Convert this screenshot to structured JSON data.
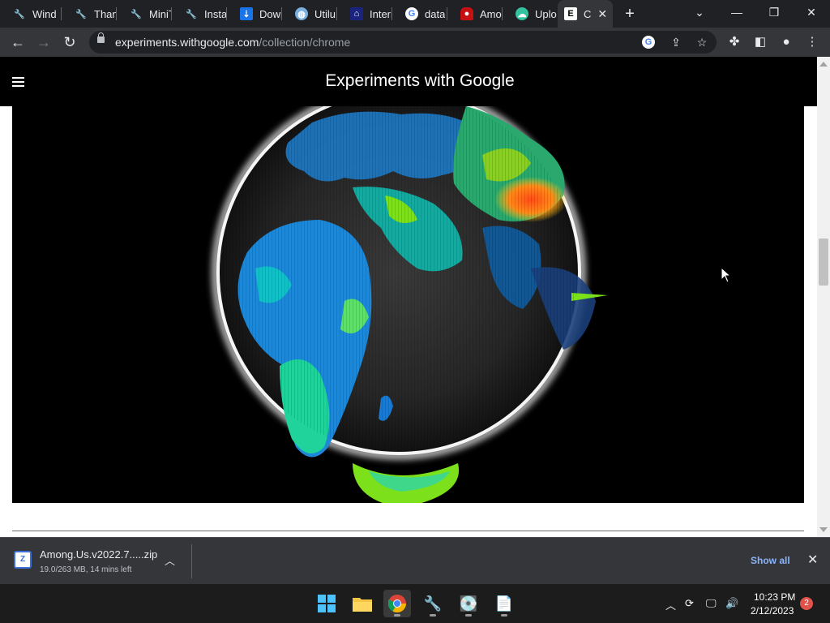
{
  "browser": {
    "tabs": [
      {
        "label": "Wind",
        "icon": "wrench-icon"
      },
      {
        "label": "Than",
        "icon": "wrench-icon"
      },
      {
        "label": "MiniT",
        "icon": "wrench-icon"
      },
      {
        "label": "Instal",
        "icon": "wrench-icon"
      },
      {
        "label": "Dowr",
        "icon": "download-site-icon"
      },
      {
        "label": "Utilu",
        "icon": "globe-icon"
      },
      {
        "label": "Intern",
        "icon": "internet-archive-icon"
      },
      {
        "label": "data",
        "icon": "google-icon"
      },
      {
        "label": "Amor",
        "icon": "among-us-icon"
      },
      {
        "label": "Uplo",
        "icon": "cloud-upload-icon"
      },
      {
        "label": "C",
        "icon": "experiments-icon"
      }
    ],
    "url_domain": "experiments.withgoogle.com",
    "url_path": "/collection/chrome"
  },
  "page": {
    "site_title": "Experiments with Google"
  },
  "download": {
    "filename": "Among.Us.v2022.7.....zip",
    "status": "19.0/263 MB, 14 mins left",
    "show_all": "Show all"
  },
  "taskbar": {
    "time": "10:23 PM",
    "date": "2/12/2023",
    "notifications": "2"
  },
  "colors": {
    "accent_link": "#8ab4f8",
    "tab_strip": "#202124",
    "toolbar": "#35363a"
  }
}
